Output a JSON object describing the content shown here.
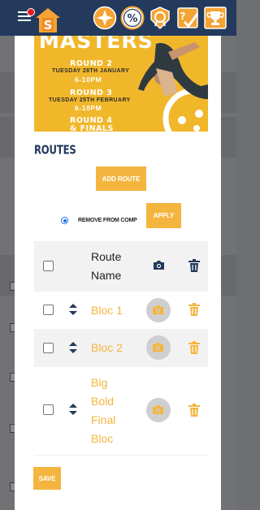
{
  "header": {
    "menu_icon": "hamburger-icon",
    "logo_letter": "S",
    "icons": [
      "compass-star-icon",
      "percent-icon",
      "badge-shield-icon",
      "checklist-icon",
      "trophy-icon"
    ]
  },
  "banner": {
    "title": "MASTERS",
    "round2": "ROUND 2",
    "round2_date": "TUESDAY 28TH JANUARY",
    "round2_time": "6-10PM",
    "round3": "ROUND 3",
    "round3_date": "TUESDAY 25TH FEBRUARY",
    "round3_time": "6-10PM",
    "round4": "ROUND 4",
    "round4_sub": "& FINALS"
  },
  "routes": {
    "title": "ROUTES",
    "add_route_label": "ADD ROUTE",
    "remove_label": "REMOVE FROM COMP",
    "apply_label": "APPLY",
    "save_label": "SAVE",
    "columns": {
      "name_line1": "Route",
      "name_line2": "Name"
    },
    "items": [
      {
        "name": "Bloc 1"
      },
      {
        "name": "Bloc 2"
      },
      {
        "name_lines": [
          "Big",
          "Bold",
          "Final",
          "Bloc"
        ]
      }
    ]
  },
  "colors": {
    "header_bg": "#233a5c",
    "accent": "#f4b53f",
    "banner": "#f1b72b",
    "badge": "#e11b22"
  }
}
